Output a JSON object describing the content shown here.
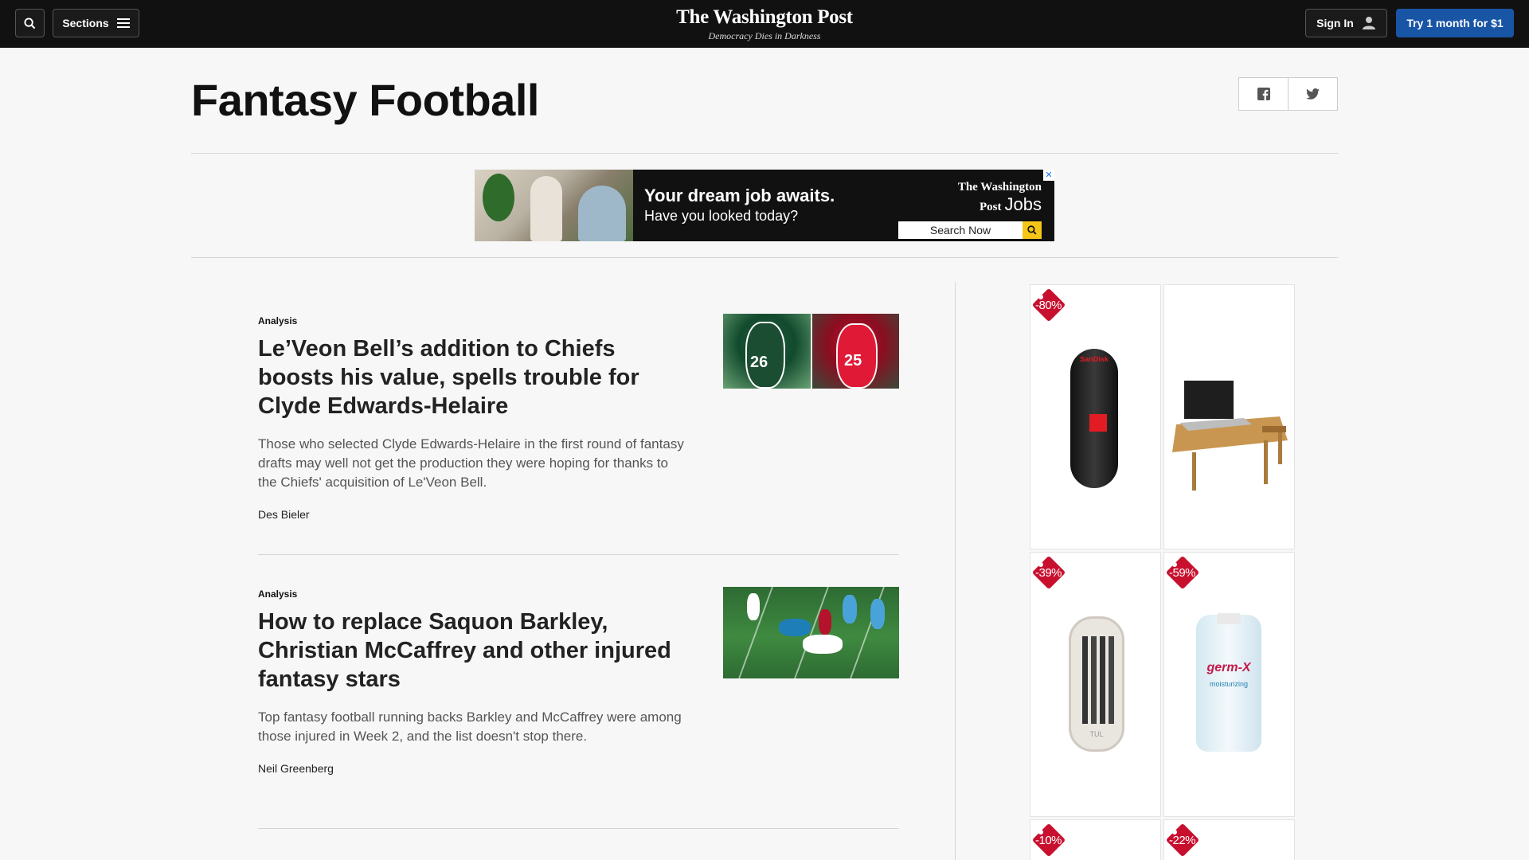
{
  "topbar": {
    "sections_label": "Sections",
    "logo_name": "The Washington Post",
    "logo_tagline": "Democracy Dies in Darkness",
    "signin_label": "Sign In",
    "try_label": "Try 1 month for $1"
  },
  "page": {
    "title": "Fantasy Football"
  },
  "banner_ad": {
    "headline": "Your dream job awaits.",
    "subline": "Have you looked today?",
    "brand": "The Washington Post",
    "brand_suffix": "Jobs",
    "search_label": "Search Now"
  },
  "articles": [
    {
      "kicker": "Analysis",
      "headline": "Le’Veon Bell’s addition to Chiefs boosts his value, spells trouble for Clyde Edwards-Helaire",
      "blurb": "Those who selected Clyde Edwards-Helaire in the first round of fantasy drafts may well not get the production they were hoping for thanks to the Chiefs' acquisition of Le'Veon Bell.",
      "byline": "Des Bieler",
      "jersey_left": "26",
      "jersey_right": "25"
    },
    {
      "kicker": "Analysis",
      "headline": "How to replace Saquon Barkley, Christian McCaffrey and other injured fantasy stars",
      "blurb": "Top fantasy football running backs Barkley and McCaffrey were among those injured in Week 2, and the list doesn't stop there.",
      "byline": "Neil Greenberg"
    }
  ],
  "side_ad": {
    "discounts": [
      "-80%",
      "-39%",
      "-59%",
      "-10%",
      "-22%"
    ],
    "product_labels": [
      "SanDisk",
      "TUL",
      "germ-X",
      "moisturizing"
    ]
  },
  "colors": {
    "topbar_bg": "#111111",
    "subscribe_blue": "#1955a5",
    "badge_red": "#c8102e",
    "page_bg": "#f7f7f7"
  }
}
